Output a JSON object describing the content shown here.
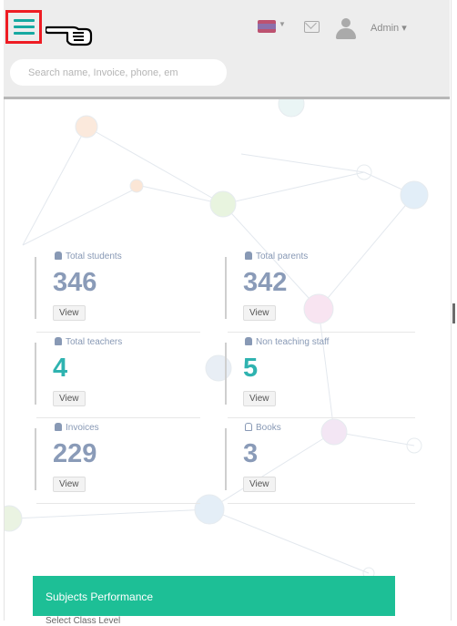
{
  "header": {
    "user_name": "Admin",
    "search_placeholder": "Search name, Invoice, phone, em",
    "icons": {
      "menu": "hamburger-icon",
      "pointer": "pointing-hand-icon",
      "flag": "flag-icon",
      "mail": "mail-icon",
      "user": "user-icon"
    },
    "accent_color": "#16a9a1",
    "highlight_color": "#ee1c24"
  },
  "stats": [
    {
      "label": "Total students",
      "value": "346",
      "button": "View",
      "color": "#8a9bb8",
      "icon": "user-icon"
    },
    {
      "label": "Total parents",
      "value": "342",
      "button": "View",
      "color": "#8a9bb8",
      "icon": "user-icon"
    },
    {
      "label": "Total teachers",
      "value": "4",
      "button": "View",
      "color": "#2fb3b0",
      "icon": "user-icon"
    },
    {
      "label": "Non teaching staff",
      "value": "5",
      "button": "View",
      "color": "#2fb3b0",
      "icon": "user-icon"
    },
    {
      "label": "Invoices",
      "value": "229",
      "button": "View",
      "color": "#8a9bb8",
      "icon": "invoice-icon"
    },
    {
      "label": "Books",
      "value": "3",
      "button": "View",
      "color": "#8a9bb8",
      "icon": "book-icon"
    }
  ],
  "panel": {
    "title": "Subjects Performance",
    "subtitle": "Select Class Level",
    "color": "#1dbf96"
  }
}
